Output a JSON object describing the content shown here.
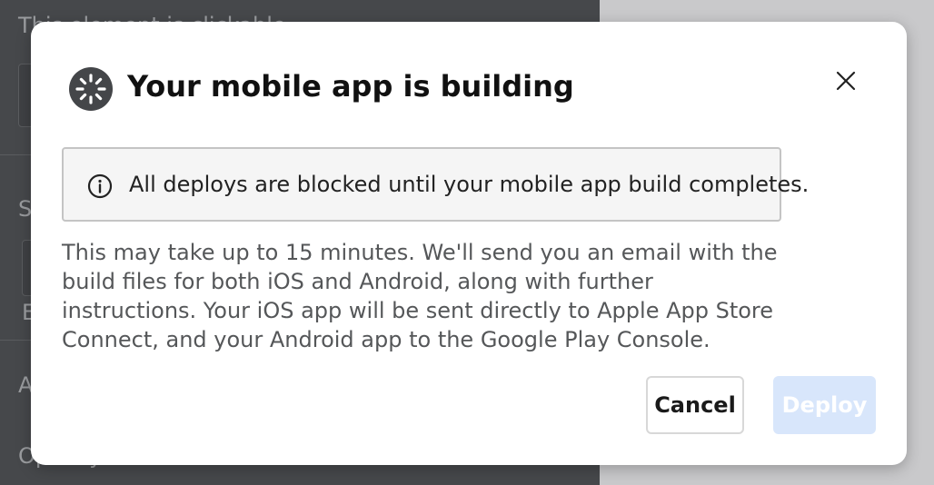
{
  "background": {
    "text_1": "This element is clickable",
    "text_2": "S",
    "text_3": "E",
    "text_4": "A",
    "text_5": "Opacity"
  },
  "modal": {
    "title": "Your mobile app is building",
    "alert": "All deploys are blocked until your mobile app build completes.",
    "body": "This may take up to 15 minutes. We'll send you an email with the build files for both iOS and Android, along with further instructions. Your iOS app will be sent directly to Apple App Store Connect, and your Android app to the Google Play Console.",
    "cancel_label": "Cancel",
    "deploy_label": "Deploy",
    "deploy_disabled": true
  },
  "icons": {
    "title_icon": "spinner-icon",
    "close_icon": "close-icon",
    "alert_icon": "info-icon"
  },
  "colors": {
    "deploy_disabled_bg": "#d8e6fb",
    "alert_bg": "#f5f5f5",
    "backdrop": "#46484b"
  }
}
